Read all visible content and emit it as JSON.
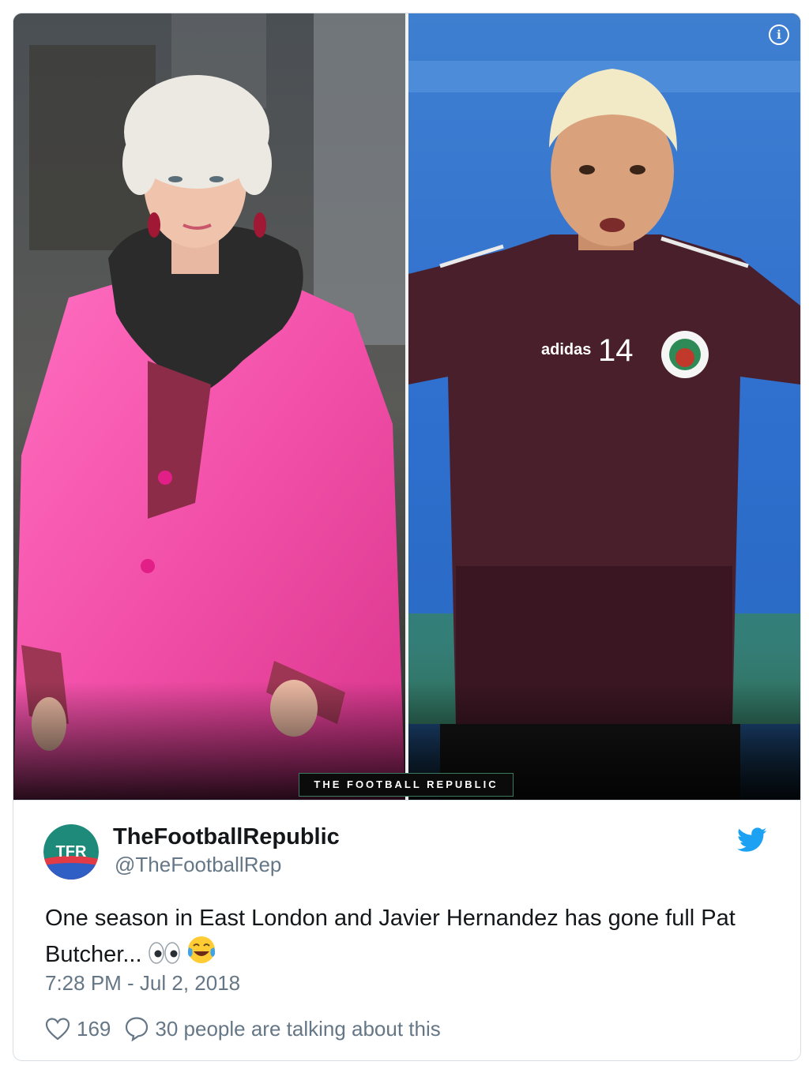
{
  "media": {
    "watermark": "THE FOOTBALL REPUBLIC",
    "info_icon": "info-icon",
    "jersey_number": "14",
    "jersey_brand": "adidas"
  },
  "author": {
    "avatar_text": "TFR",
    "name": "TheFootballRepublic",
    "handle": "@TheFootballRep",
    "platform_icon": "twitter-bird-icon"
  },
  "tweet": {
    "text": "One season in East London and Javier Hernandez has gone full Pat Butcher...",
    "emojis": [
      "eyes-emoji",
      "tears-of-joy-emoji"
    ],
    "timestamp": "7:28 PM - Jul 2, 2018"
  },
  "actions": {
    "likes": "169",
    "conversation": "30 people are talking about this"
  },
  "colors": {
    "link_blue": "#1da1f2",
    "muted_text": "#657786",
    "body_text": "#14171a",
    "avatar_teal": "#1d8a7a"
  }
}
